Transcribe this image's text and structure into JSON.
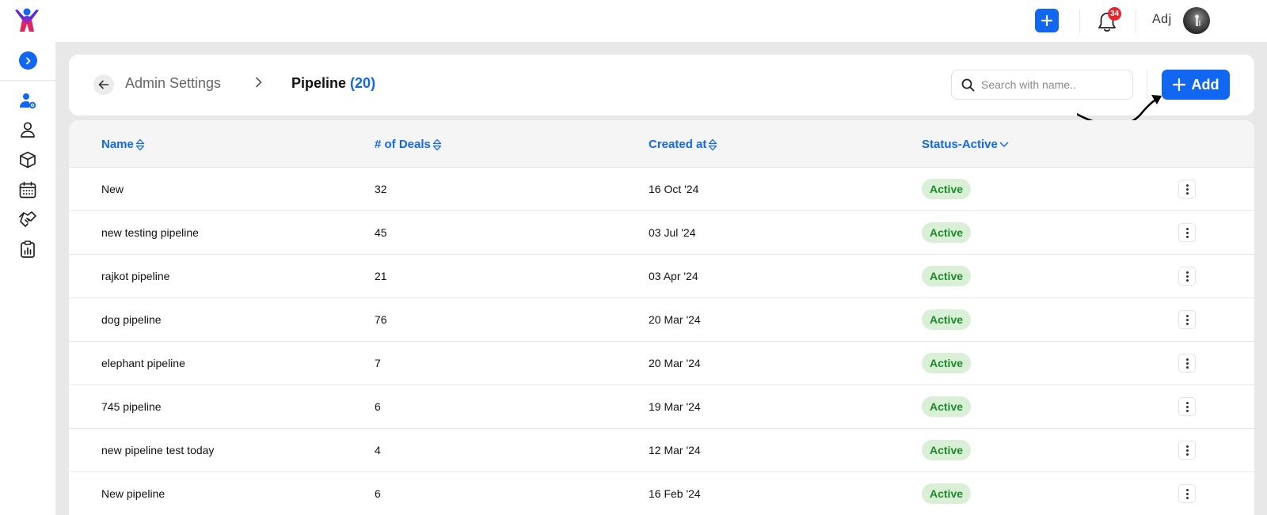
{
  "app": {
    "logo_icon": "people-logo-icon",
    "accent": "#1167f2"
  },
  "topbar": {
    "add_icon": "plus-icon",
    "notification_count": "34",
    "user_name": "Adj"
  },
  "breadcrumb": {
    "parent": "Admin Settings",
    "current": "Pipeline",
    "count": "(20)"
  },
  "search": {
    "placeholder": "Search with name.."
  },
  "add_button": {
    "label": "Add"
  },
  "table": {
    "headers": {
      "name": "Name",
      "deals": "# of Deals",
      "created": "Created at",
      "status": "Status-Active"
    },
    "rows": [
      {
        "name": "New",
        "deals": "32",
        "created": "16 Oct '24",
        "status": "Active"
      },
      {
        "name": "new testing pipeline",
        "deals": "45",
        "created": "03 Jul '24",
        "status": "Active"
      },
      {
        "name": "rajkot pipeline",
        "deals": "21",
        "created": "03 Apr '24",
        "status": "Active"
      },
      {
        "name": "dog pipeline",
        "deals": "76",
        "created": "20 Mar '24",
        "status": "Active"
      },
      {
        "name": "elephant pipeline",
        "deals": "7",
        "created": "20 Mar '24",
        "status": "Active"
      },
      {
        "name": "745 pipeline",
        "deals": "6",
        "created": "19 Mar '24",
        "status": "Active"
      },
      {
        "name": "new pipeline test today",
        "deals": "4",
        "created": "12 Mar '24",
        "status": "Active"
      },
      {
        "name": "New pipeline",
        "deals": "6",
        "created": "16 Feb '24",
        "status": "Active"
      }
    ]
  }
}
